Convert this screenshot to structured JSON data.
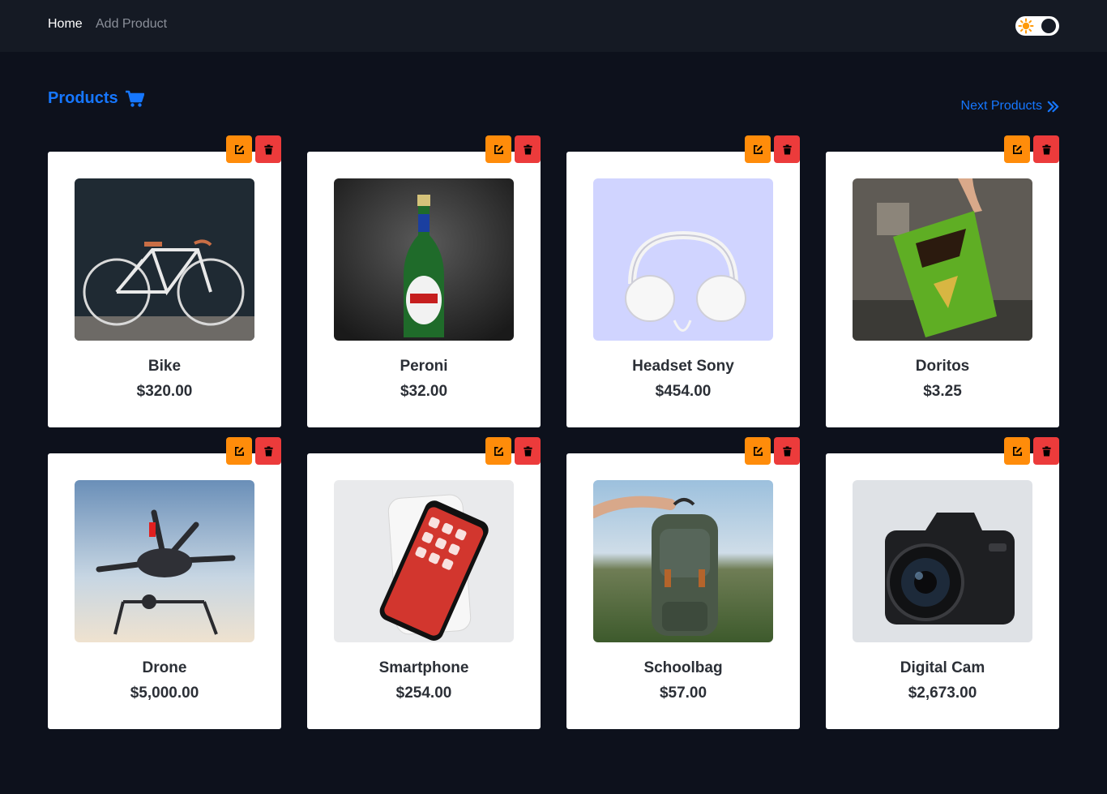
{
  "nav": {
    "home_label": "Home",
    "add_product_label": "Add Product"
  },
  "theme_toggle": {
    "icon": "sun-icon",
    "state": "dark"
  },
  "page": {
    "title": "Products",
    "title_icon": "cart-icon",
    "next_label": "Next Products",
    "next_icon": "double-chevron-right-icon"
  },
  "colors": {
    "accent": "#1677ff",
    "edit": "#ff8c0a",
    "delete": "#ec3b3b",
    "background": "#0d111c",
    "navbar": "#151a24"
  },
  "products": [
    {
      "name": "Bike",
      "price": "$320.00",
      "image": "bike-image"
    },
    {
      "name": "Peroni",
      "price": "$32.00",
      "image": "peroni-bottle-image"
    },
    {
      "name": "Headset Sony",
      "price": "$454.00",
      "image": "headphones-image"
    },
    {
      "name": "Doritos",
      "price": "$3.25",
      "image": "doritos-bag-image"
    },
    {
      "name": "Drone",
      "price": "$5,000.00",
      "image": "drone-image"
    },
    {
      "name": "Smartphone",
      "price": "$254.00",
      "image": "smartphone-image"
    },
    {
      "name": "Schoolbag",
      "price": "$57.00",
      "image": "backpack-image"
    },
    {
      "name": "Digital Cam",
      "price": "$2,673.00",
      "image": "camera-image"
    }
  ]
}
